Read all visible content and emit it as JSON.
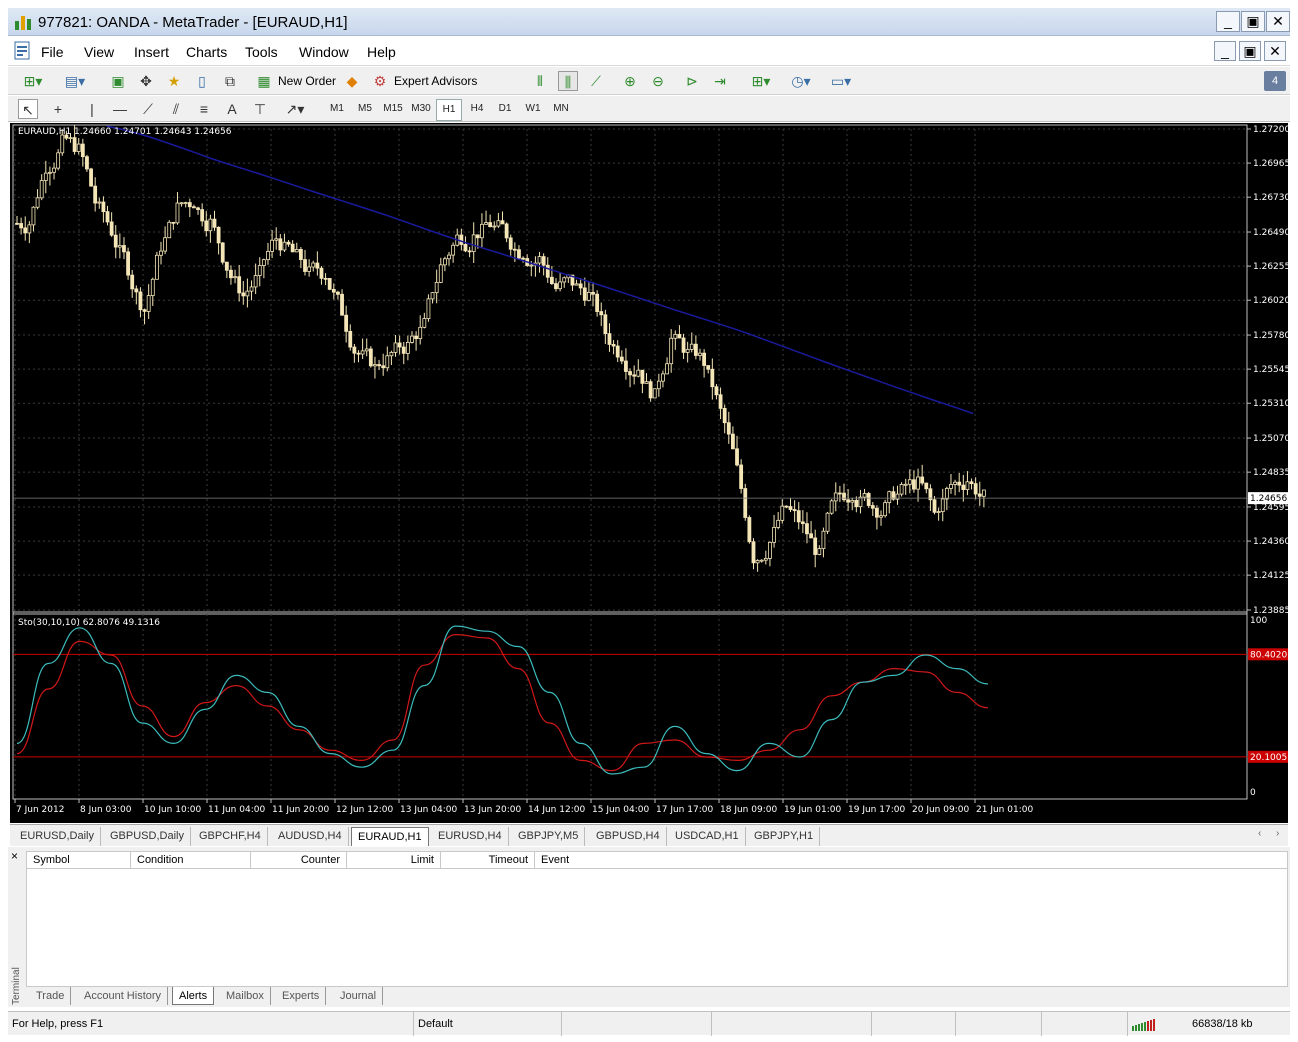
{
  "window": {
    "title": "977821: OANDA - MetaTrader - [EURAUD,H1]",
    "minimize": "_",
    "restore": "▣",
    "close": "✕"
  },
  "menu": [
    "File",
    "View",
    "Insert",
    "Charts",
    "Tools",
    "Window",
    "Help"
  ],
  "toolbar": {
    "new_order": "New Order",
    "expert_advisors": "Expert Advisors",
    "timeframes": [
      "M1",
      "M5",
      "M15",
      "M30",
      "H1",
      "H4",
      "D1",
      "W1",
      "MN"
    ],
    "active_timeframe": "H1",
    "badge": "4"
  },
  "chart": {
    "info": "EURAUD,H1  1.24660 1.24701 1.24643 1.24656",
    "price_ticks": [
      "1.27200",
      "1.26965",
      "1.26730",
      "1.26490",
      "1.26255",
      "1.26020",
      "1.25780",
      "1.25545",
      "1.25310",
      "1.25070",
      "1.24835",
      "1.24595",
      "1.24360",
      "1.24125",
      "1.23885"
    ],
    "current_price": "1.24656",
    "stoch_info": "Sto(30,10,10) 62.8076 49.1316",
    "stoch_levels": {
      "top": "100",
      "upper": "80.4020",
      "lower": "20.1005",
      "bottom": "0"
    },
    "time_labels": [
      "7 Jun 2012",
      "8 Jun 03:00",
      "10 Jun 10:00",
      "11 Jun 04:00",
      "11 Jun 20:00",
      "12 Jun 12:00",
      "13 Jun 04:00",
      "13 Jun 20:00",
      "14 Jun 12:00",
      "15 Jun 04:00",
      "17 Jun 17:00",
      "18 Jun 09:00",
      "19 Jun 01:00",
      "19 Jun 17:00",
      "20 Jun 09:00",
      "21 Jun 01:00"
    ],
    "colors": {
      "background": "#000000",
      "candle": "#f5e6b8",
      "ma": "#1a1a9c",
      "stoch_main": "#3cbcbc",
      "stoch_signal": "#d01818",
      "level": "#cc0000"
    }
  },
  "chart_data": {
    "type": "line",
    "title": "EURAUD,H1",
    "ylim": [
      1.23885,
      1.272
    ],
    "series": [
      {
        "name": "EURAUD,H1",
        "values": [
          1.2655,
          1.2695,
          1.271,
          1.2705,
          1.267,
          1.265,
          1.2625,
          1.2595,
          1.264,
          1.2665,
          1.267,
          1.2655,
          1.2625,
          1.2605,
          1.262,
          1.2645,
          1.2635,
          1.262,
          1.262,
          1.2595,
          1.2565,
          1.2555,
          1.2565,
          1.257,
          1.2585,
          1.2625,
          1.2645,
          1.2645,
          1.2655,
          1.2648,
          1.2635,
          1.263,
          1.261,
          1.2615,
          1.2605,
          1.258,
          1.2565,
          1.2555,
          1.2535,
          1.2575,
          1.2565,
          1.256,
          1.2525,
          1.2485,
          1.2425,
          1.2435,
          1.246,
          1.2445,
          1.2425,
          1.2465,
          1.247,
          1.2465,
          1.2458,
          1.247,
          1.2475,
          1.2455,
          1.2475,
          1.2478,
          1.2466
        ]
      }
    ],
    "stochastic": {
      "name": "Sto(30,10,10)",
      "main": [
        28,
        75,
        96,
        75,
        40,
        28,
        48,
        68,
        58,
        38,
        22,
        14,
        24,
        62,
        97,
        94,
        85,
        58,
        28,
        10,
        14,
        38,
        22,
        12,
        28,
        20,
        42,
        64,
        68,
        80,
        72,
        63
      ],
      "signal": [
        22,
        60,
        88,
        80,
        50,
        32,
        52,
        62,
        50,
        36,
        24,
        18,
        30,
        74,
        92,
        90,
        72,
        40,
        18,
        12,
        28,
        30,
        20,
        18,
        24,
        36,
        56,
        64,
        72,
        70,
        58,
        49
      ],
      "levels": [
        80.402,
        20.1005
      ]
    }
  },
  "chart_tabs": [
    "EURUSD,Daily",
    "GBPUSD,Daily",
    "GBPCHF,H4",
    "AUDUSD,H4",
    "EURAUD,H1",
    "EURUSD,H4",
    "GBPJPY,M5",
    "GBPUSD,H4",
    "USDCAD,H1",
    "GBPJPY,H1"
  ],
  "active_chart_tab": "EURAUD,H1",
  "terminal": {
    "label": "Terminal",
    "columns": [
      "Symbol",
      "Condition",
      "Counter",
      "Limit",
      "Timeout",
      "Event"
    ],
    "tabs": [
      "Trade",
      "Account History",
      "Alerts",
      "Mailbox",
      "Experts",
      "Journal"
    ],
    "active_tab": "Alerts"
  },
  "status": {
    "help": "For Help, press F1",
    "profile": "Default",
    "traffic": "66838/18 kb"
  }
}
